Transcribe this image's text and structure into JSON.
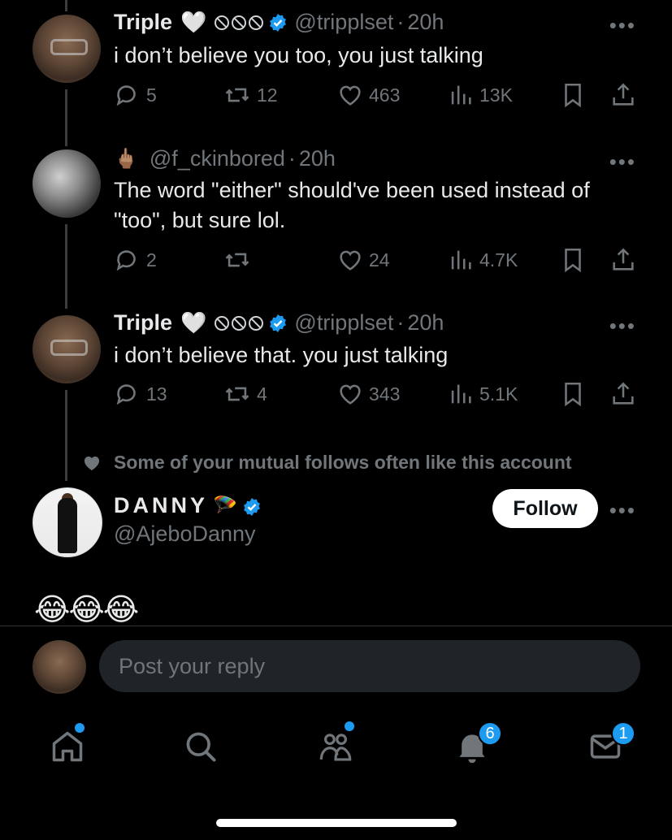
{
  "tweets": [
    {
      "author_name": "Triple",
      "name_emoji": "🤍",
      "handle": "@tripplset",
      "separator": "·",
      "time": "20h",
      "text": "i don’t believe you too, you just talking",
      "replies": "5",
      "reposts": "12",
      "likes": "463",
      "views": "13K"
    },
    {
      "author_name": "",
      "name_emoji": "🖕🏽",
      "handle": "@f_ckinbored",
      "separator": "·",
      "time": "20h",
      "text": "The word \"either\" should've been used instead of \"too\", but sure lol.",
      "replies": "2",
      "reposts": "",
      "likes": "24",
      "views": "4.7K"
    },
    {
      "author_name": "Triple",
      "name_emoji": "🤍",
      "handle": "@tripplset",
      "separator": "·",
      "time": "20h",
      "text": "i don’t believe that. you just talking",
      "replies": "13",
      "reposts": "4",
      "likes": "343",
      "views": "5.1K"
    }
  ],
  "social_context": "Some of your mutual follows often like this account",
  "suggested": {
    "name": "DANNY",
    "name_emoji": "🪂",
    "handle": "@AjeboDanny",
    "follow_label": "Follow",
    "post_text": "😂😂😂"
  },
  "reply_box": {
    "placeholder": "Post your reply"
  },
  "nav": {
    "notifications_count": "6",
    "messages_count": "1"
  },
  "colors": {
    "background": "#000000",
    "text": "#e7e9ea",
    "muted": "#71767b",
    "accent": "#1d9bf0"
  },
  "icons": [
    "reply-icon",
    "repost-icon",
    "like-icon",
    "views-icon",
    "bookmark-icon",
    "share-icon",
    "more-icon",
    "verified-icon",
    "home-icon",
    "search-icon",
    "communities-icon",
    "notifications-icon",
    "messages-icon"
  ]
}
